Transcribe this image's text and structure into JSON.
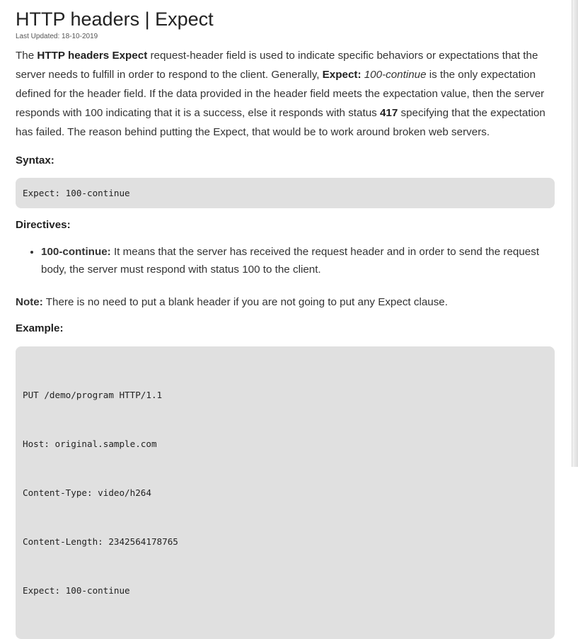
{
  "title": "HTTP headers | Expect",
  "last_updated": "Last Updated: 18-10-2019",
  "intro": {
    "t1": "The ",
    "b1": "HTTP headers Expect",
    "t2": " request-header field is used to indicate specific behaviors or expectations that the server needs to fulfill in order to respond to the client. Generally, ",
    "b2": "Expect:",
    "i1": " 100-continue",
    "t3": " is the only expectation defined for the header field. If the data provided in the header field meets the expectation value, then the server responds with 100 indicating that it is a success, else it responds with status ",
    "b3": "417",
    "t4": " specifying that the expectation has failed. The reason behind putting the Expect, that would be to work around broken web servers."
  },
  "syntax": {
    "heading": "Syntax:",
    "code": "Expect: 100-continue"
  },
  "directives": {
    "heading": "Directives:",
    "items": [
      {
        "term": "100-continue:",
        "desc": " It means that the server has received the request header and in order to send the request body, the server must respond with status 100 to the client."
      }
    ]
  },
  "note": {
    "label": "Note:",
    "text": " There is no need to put a blank header if you are not going to put any Expect clause."
  },
  "example": {
    "heading": "Example:",
    "lines": [
      "PUT /demo/program HTTP/1.1",
      "Host: original.sample.com",
      "Content-Type: video/h264",
      "Content-Length: 2342564178765",
      "Expect: 100-continue"
    ]
  }
}
